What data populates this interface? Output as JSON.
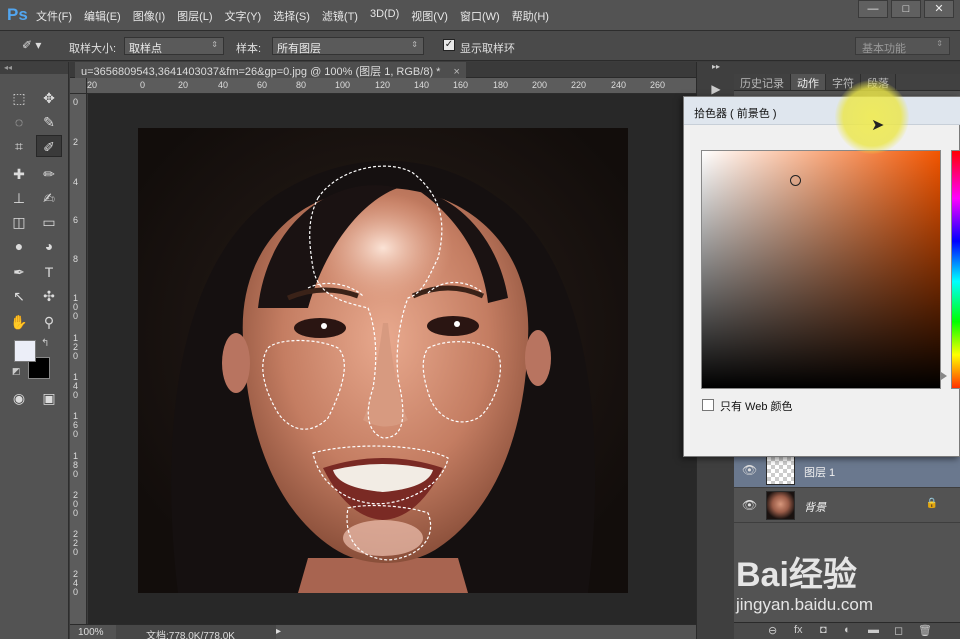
{
  "app": {
    "logo": "Ps",
    "menu": [
      "文件(F)",
      "编辑(E)",
      "图像(I)",
      "图层(L)",
      "文字(Y)",
      "选择(S)",
      "滤镜(T)",
      "3D(D)",
      "视图(V)",
      "窗口(W)",
      "帮助(H)"
    ],
    "window_buttons": [
      "—",
      "□",
      "✕"
    ]
  },
  "options_bar": {
    "sample_size_label": "取样大小:",
    "sample_size_value": "取样点",
    "sample_label": "样本:",
    "sample_value": "所有图层",
    "show_ring_label": "显示取样环",
    "show_ring_checked": true,
    "workspace": "基本功能"
  },
  "document": {
    "tab_title": "u=3656809543,3641403037&fm=26&gp=0.jpg @ 100% (图层 1, RGB/8) *",
    "tab_close": "×",
    "ruler_top": [
      "20",
      "0",
      "20",
      "40",
      "60",
      "80",
      "100",
      "120",
      "140",
      "160",
      "180",
      "200",
      "220",
      "240",
      "260",
      "280",
      "300"
    ],
    "ruler_left": [
      "0",
      "2",
      "4",
      "6",
      "8",
      "100",
      "120",
      "140",
      "160",
      "180",
      "200",
      "220",
      "240",
      "260",
      "280",
      "300"
    ],
    "zoom": "100%",
    "doc_info": "文档:778.0K/778.0K"
  },
  "panels": {
    "tabs": [
      "历史记录",
      "动作",
      "字符",
      "段落"
    ],
    "active_tab": 1,
    "layers": [
      {
        "name": "图层 1",
        "selected": true,
        "transparent": true,
        "locked": false
      },
      {
        "name": "背景",
        "selected": false,
        "transparent": false,
        "locked": true
      }
    ],
    "footer_icons": [
      "link-icon",
      "fx-icon",
      "mask-icon",
      "adjustment-icon",
      "group-icon",
      "new-layer-icon",
      "trash-icon"
    ],
    "footer_glyphs": [
      "⊖",
      "fx",
      "◘",
      "◐",
      "▬",
      "◻",
      "🗑"
    ]
  },
  "color_picker": {
    "title": "拾色器 ( 前景色 )",
    "web_only_label": "只有 Web 颜色",
    "web_only_checked": false,
    "selected_color": "#eceef8",
    "hue_color": "#f25500"
  },
  "watermark": {
    "brand": "Bai经验",
    "url": "jingyan.baidu.com"
  },
  "tools": [
    "marquee-icon",
    "move-icon",
    "lasso-icon",
    "quick-select-icon",
    "crop-icon",
    "eyedropper-icon",
    "healing-icon",
    "brush-icon",
    "stamp-icon",
    "history-brush-icon",
    "eraser-icon",
    "gradient-icon",
    "blur-icon",
    "dodge-icon",
    "pen-icon",
    "type-icon",
    "path-select-icon",
    "shape-icon",
    "hand-icon",
    "zoom-icon",
    "quick-mask-icon",
    "screen-mode-icon"
  ],
  "tool_glyphs": [
    "⬚",
    "✥",
    "◌",
    "✎",
    "⌗",
    "✐",
    "✚",
    "✏",
    "⊥",
    "✍",
    "◫",
    "▭",
    "●",
    "◕",
    "✒",
    "T",
    "↖",
    "✣",
    "✋",
    "⚲",
    "◉",
    "▣"
  ]
}
